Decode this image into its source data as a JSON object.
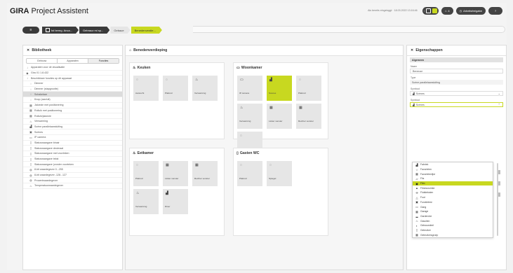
{
  "app": {
    "brand_bold": "GIRA",
    "brand_rest": " Project Assistent",
    "status": "Als bereits eingeloggt · 18.03.2022 13:16:46",
    "user_label": "4",
    "sched_label": "Arbeitsfreigabe",
    "help_label": "?"
  },
  "breadcrumb": {
    "home": "≡",
    "items": [
      "Ist bereg. Anca...",
      "Gebrauz mi sp...",
      "Gebaue",
      "Benedenverdie..."
    ]
  },
  "library": {
    "title": "Bibliotheek",
    "tabs": [
      "Gebouw",
      "Apparaten",
      "Functies"
    ],
    "group": "Apparaten voor de visualisatie",
    "items": [
      {
        "icon": "◆",
        "label": "Gira X1 1.8.432"
      },
      {
        "icon": "↓",
        "label": "Beschikbare functies op dit apparaat"
      },
      {
        "icon": "◌",
        "label": "Dimmer"
      },
      {
        "icon": "◌",
        "label": "Dimmer (stapgrootte)"
      },
      {
        "icon": "◌",
        "label": "Schakelaar"
      },
      {
        "icon": "◌",
        "label": "Knop (aan/uit)"
      },
      {
        "icon": "▦",
        "label": "Jaloezie met positionering"
      },
      {
        "icon": "▦",
        "label": "Rolluik met positionering"
      },
      {
        "icon": "▦",
        "label": "Rolluik/jaloezie"
      },
      {
        "icon": "♨",
        "label": "Verwarming"
      },
      {
        "icon": "▟",
        "label": "Scène parallelaansluiting"
      },
      {
        "icon": "▣",
        "label": "Scènes"
      },
      {
        "icon": "▭",
        "label": "IP camera"
      },
      {
        "icon": "▯",
        "label": "Statuswaargave binair"
      },
      {
        "icon": "▯",
        "label": "Statuswaargave decimaal"
      },
      {
        "icon": "▯",
        "label": "Statuswaargave met voorteken"
      },
      {
        "icon": "▯",
        "label": "Statuswaargave tekst"
      },
      {
        "icon": "▯",
        "label": "Statuswaargave (zonder voorteken"
      },
      {
        "icon": "◍",
        "label": "8-bit waardegever 0...255"
      },
      {
        "icon": "◍",
        "label": "8-bit waardegever -128...127"
      },
      {
        "icon": "◍",
        "label": "Procentwaardegever"
      },
      {
        "icon": "♨",
        "label": "Temperatuurwaardegever"
      }
    ]
  },
  "main": {
    "title": "Benedenverdieping",
    "rooms": [
      {
        "name": "Keuken",
        "icon": "♨",
        "tiles": [
          {
            "icon": "◌",
            "label": "Aanrecht"
          },
          {
            "icon": "◌",
            "label": "Plafond"
          },
          {
            "icon": "♨",
            "label": "Verwarming"
          }
        ]
      },
      {
        "name": "Woonkamer",
        "icon": "▭",
        "tiles": [
          {
            "icon": "▭",
            "label": "IP camera"
          },
          {
            "icon": "▟",
            "label": "Scenes"
          },
          {
            "icon": "◌",
            "label": "Plafond"
          },
          {
            "icon": "♨",
            "label": "Verwarming"
          },
          {
            "icon": "▦",
            "label": "Linker venster"
          },
          {
            "icon": "▦",
            "label": "Rechter venster"
          },
          {
            "icon": "◌",
            "label": ""
          }
        ]
      },
      {
        "name": "Eetkamer",
        "icon": "♨",
        "tiles": [
          {
            "icon": "◌",
            "label": "Plafond"
          },
          {
            "icon": "▦",
            "label": "Linker venster"
          },
          {
            "icon": "▦",
            "label": "Rechter venster"
          },
          {
            "icon": "♨",
            "label": "Verwarming"
          },
          {
            "icon": "▟",
            "label": "Diner"
          }
        ]
      },
      {
        "name": "Gasten WC",
        "icon": "▯",
        "tiles": [
          {
            "icon": "◌",
            "label": "Plafond"
          },
          {
            "icon": "◌",
            "label": "Spiegel"
          }
        ]
      }
    ]
  },
  "properties": {
    "title": "Eigenschappen",
    "section": "Algemeen",
    "name_label": "Naam",
    "name_value": "Beneuse",
    "type_label": "Type",
    "type_value": "Scène parallelaansluiting",
    "icon_label": "Symbool",
    "icon_value": "Scènes",
    "symbol_label": "Symbool",
    "symbol_value": "Scènes",
    "dropdown": [
      {
        "icon": "▟",
        "label": "Fabriek"
      },
      {
        "icon": "☆",
        "label": "Favorieten"
      },
      {
        "icon": "▦",
        "label": "Favorietenlijst"
      },
      {
        "icon": "▱",
        "label": "Fiis"
      },
      {
        "icon": "▣",
        "label": "Film"
      },
      {
        "icon": "▲",
        "label": "Fitnessruimte"
      },
      {
        "icon": "✣",
        "label": "Fluitdeksten"
      },
      {
        "icon": "△",
        "label": "Fout"
      },
      {
        "icon": "▣",
        "label": "Functietest"
      },
      {
        "icon": "▭",
        "label": "Gang"
      },
      {
        "icon": "▦",
        "label": "Garage"
      },
      {
        "icon": "▂",
        "label": "Garderobe"
      },
      {
        "icon": "♨",
        "label": "Gasolien"
      },
      {
        "icon": "◐",
        "label": "Gebouwdeel"
      },
      {
        "icon": "▯",
        "label": "Gebruiker"
      },
      {
        "icon": "▦",
        "label": "Gebruikersgroep"
      }
    ],
    "selected_index": 4
  }
}
